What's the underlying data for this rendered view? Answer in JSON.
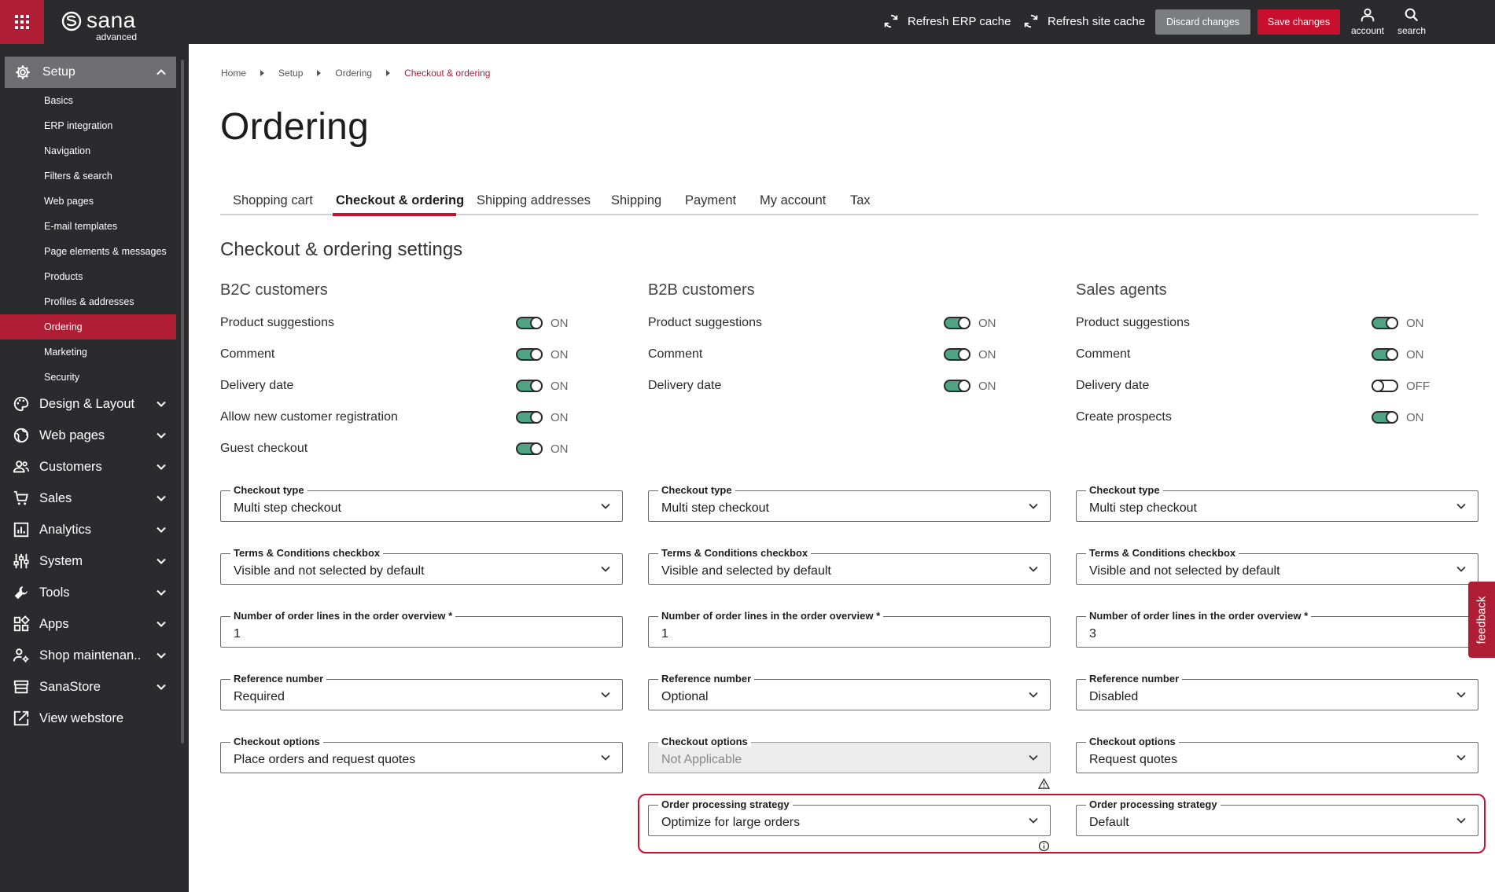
{
  "brand": {
    "name": "sana",
    "edition": "advanced",
    "accent_color": "#b01e35",
    "sidebar_bg": "#2b2b2e",
    "toggle_on_color": "#4fa583"
  },
  "topbar": {
    "refresh_erp": "Refresh ERP cache",
    "refresh_site": "Refresh site cache",
    "discard": "Discard changes",
    "save": "Save changes",
    "account": "account",
    "search": "search"
  },
  "sidebar": {
    "setup_label": "Setup",
    "sub_items": [
      {
        "label": "Basics",
        "active": false
      },
      {
        "label": "ERP integration",
        "active": false
      },
      {
        "label": "Navigation",
        "active": false
      },
      {
        "label": "Filters & search",
        "active": false
      },
      {
        "label": "Web pages",
        "active": false
      },
      {
        "label": "E-mail templates",
        "active": false
      },
      {
        "label": "Page elements & messages",
        "active": false
      },
      {
        "label": "Products",
        "active": false
      },
      {
        "label": "Profiles & addresses",
        "active": false
      },
      {
        "label": "Ordering",
        "active": true
      },
      {
        "label": "Marketing",
        "active": false
      },
      {
        "label": "Security",
        "active": false
      }
    ],
    "main_items": [
      {
        "label": "Design & Layout",
        "icon": "palette-icon"
      },
      {
        "label": "Web pages",
        "icon": "globe-icon"
      },
      {
        "label": "Customers",
        "icon": "users-icon"
      },
      {
        "label": "Sales",
        "icon": "cart-icon"
      },
      {
        "label": "Analytics",
        "icon": "analytics-icon"
      },
      {
        "label": "System",
        "icon": "sliders-icon"
      },
      {
        "label": "Tools",
        "icon": "wrench-icon"
      },
      {
        "label": "Apps",
        "icon": "apps-icon"
      },
      {
        "label": "Shop maintenan...",
        "icon": "maintenance-icon"
      },
      {
        "label": "SanaStore",
        "icon": "store-icon"
      },
      {
        "label": "View webstore",
        "icon": "external-link-icon"
      }
    ]
  },
  "breadcrumb": [
    "Home",
    "Setup",
    "Ordering",
    "Checkout & ordering"
  ],
  "page_title": "Ordering",
  "tabs": [
    {
      "label": "Shopping cart",
      "active": false
    },
    {
      "label": "Checkout & ordering",
      "active": true
    },
    {
      "label": "Shipping addresses",
      "active": false
    },
    {
      "label": "Shipping",
      "active": false
    },
    {
      "label": "Payment",
      "active": false
    },
    {
      "label": "My account",
      "active": false
    },
    {
      "label": "Tax",
      "active": false
    }
  ],
  "section_title": "Checkout & ordering settings",
  "columns": [
    {
      "title": "B2C customers",
      "toggles": [
        {
          "label": "Product suggestions",
          "on": true,
          "state": "ON"
        },
        {
          "label": "Comment",
          "on": true,
          "state": "ON"
        },
        {
          "label": "Delivery date",
          "on": true,
          "state": "ON"
        },
        {
          "label": "Allow new customer registration",
          "on": true,
          "state": "ON"
        },
        {
          "label": "Guest checkout",
          "on": true,
          "state": "ON"
        }
      ],
      "fields": {
        "checkout_type": {
          "label": "Checkout type",
          "value": "Multi step checkout"
        },
        "terms": {
          "label": "Terms & Conditions checkbox",
          "value": "Visible and not selected by default"
        },
        "order_lines": {
          "label": "Number of order lines in the order overview *",
          "value": "1"
        },
        "reference": {
          "label": "Reference number",
          "value": "Required"
        },
        "checkout_options": {
          "label": "Checkout options",
          "value": "Place orders and request quotes",
          "disabled": false
        }
      }
    },
    {
      "title": "B2B customers",
      "toggles": [
        {
          "label": "Product suggestions",
          "on": true,
          "state": "ON"
        },
        {
          "label": "Comment",
          "on": true,
          "state": "ON"
        },
        {
          "label": "Delivery date",
          "on": true,
          "state": "ON"
        }
      ],
      "fields": {
        "checkout_type": {
          "label": "Checkout type",
          "value": "Multi step checkout"
        },
        "terms": {
          "label": "Terms & Conditions checkbox",
          "value": "Visible and selected by default"
        },
        "order_lines": {
          "label": "Number of order lines in the order overview *",
          "value": "1"
        },
        "reference": {
          "label": "Reference number",
          "value": "Optional"
        },
        "checkout_options": {
          "label": "Checkout options",
          "value": "Not Applicable",
          "disabled": true
        },
        "processing": {
          "label": "Order processing strategy",
          "value": "Optimize for large orders"
        }
      }
    },
    {
      "title": "Sales agents",
      "toggles": [
        {
          "label": "Product suggestions",
          "on": true,
          "state": "ON"
        },
        {
          "label": "Comment",
          "on": true,
          "state": "ON"
        },
        {
          "label": "Delivery date",
          "on": false,
          "state": "OFF"
        },
        {
          "label": "Create prospects",
          "on": true,
          "state": "ON"
        }
      ],
      "fields": {
        "checkout_type": {
          "label": "Checkout type",
          "value": "Multi step checkout"
        },
        "terms": {
          "label": "Terms & Conditions checkbox",
          "value": "Visible and not selected by default"
        },
        "order_lines": {
          "label": "Number of order lines in the order overview *",
          "value": "3"
        },
        "reference": {
          "label": "Reference number",
          "value": "Disabled"
        },
        "checkout_options": {
          "label": "Checkout options",
          "value": "Request quotes",
          "disabled": false
        },
        "processing": {
          "label": "Order processing strategy",
          "value": "Default"
        }
      }
    }
  ],
  "feedback": "feedback"
}
